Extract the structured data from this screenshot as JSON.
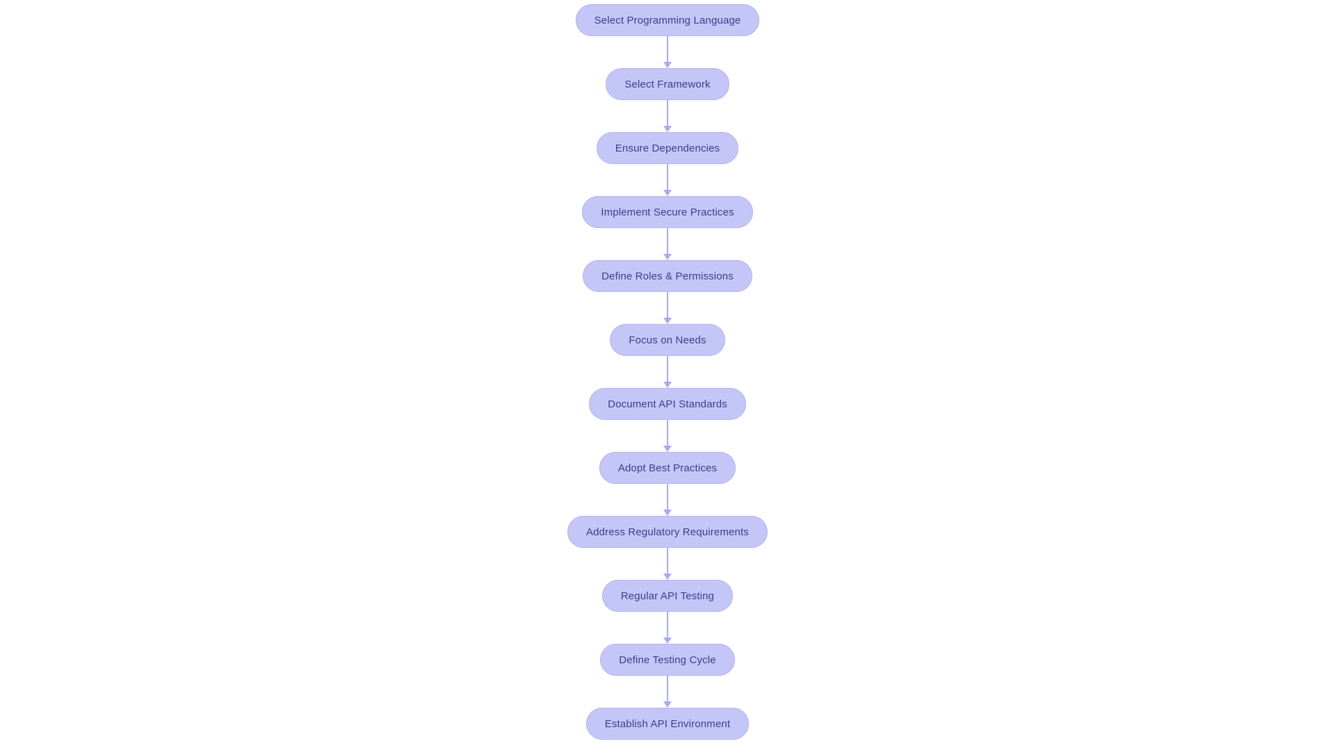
{
  "diagram": {
    "type": "flowchart",
    "orientation": "top-to-bottom",
    "title": "",
    "colors": {
      "node_fill": "#c5c6f8",
      "node_border": "#b3b4f0",
      "node_text": "#3c3c8c",
      "connector": "#a9abf0",
      "background": "#ffffff"
    },
    "node_shape": "rounded-pill",
    "connector_style": "straight-arrow-down",
    "nodes": [
      {
        "id": "n1",
        "label": "Select Programming Language"
      },
      {
        "id": "n2",
        "label": "Select Framework"
      },
      {
        "id": "n3",
        "label": "Ensure Dependencies"
      },
      {
        "id": "n4",
        "label": "Implement Secure Practices"
      },
      {
        "id": "n5",
        "label": "Define Roles & Permissions"
      },
      {
        "id": "n6",
        "label": "Focus on Needs"
      },
      {
        "id": "n7",
        "label": "Document API Standards"
      },
      {
        "id": "n8",
        "label": "Adopt Best Practices"
      },
      {
        "id": "n9",
        "label": "Address Regulatory Requirements"
      },
      {
        "id": "n10",
        "label": "Regular API Testing"
      },
      {
        "id": "n11",
        "label": "Define Testing Cycle"
      },
      {
        "id": "n12",
        "label": "Establish API Environment"
      }
    ],
    "edges": [
      {
        "from": "n1",
        "to": "n2",
        "label": ""
      },
      {
        "from": "n2",
        "to": "n3",
        "label": ""
      },
      {
        "from": "n3",
        "to": "n4",
        "label": ""
      },
      {
        "from": "n4",
        "to": "n5",
        "label": ""
      },
      {
        "from": "n5",
        "to": "n6",
        "label": ""
      },
      {
        "from": "n6",
        "to": "n7",
        "label": ""
      },
      {
        "from": "n7",
        "to": "n8",
        "label": ""
      },
      {
        "from": "n8",
        "to": "n9",
        "label": ""
      },
      {
        "from": "n9",
        "to": "n10",
        "label": ""
      },
      {
        "from": "n10",
        "to": "n11",
        "label": ""
      },
      {
        "from": "n11",
        "to": "n12",
        "label": ""
      }
    ]
  }
}
